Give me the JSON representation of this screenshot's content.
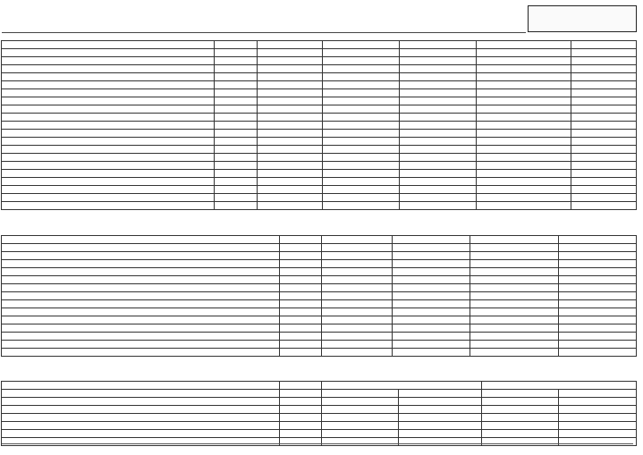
{
  "header": {
    "title": "",
    "subtitle": "",
    "box_line1": "",
    "box_line2": ""
  },
  "table1": {
    "headers": [
      "",
      "",
      "",
      "",
      "",
      "",
      ""
    ],
    "rows": [
      [
        "",
        "",
        "",
        "",
        "",
        "",
        ""
      ],
      [
        "",
        "",
        "",
        "",
        "",
        "",
        ""
      ],
      [
        "",
        "",
        "",
        "",
        "",
        "",
        ""
      ],
      [
        "",
        "",
        "",
        "",
        "",
        "",
        ""
      ],
      [
        "",
        "",
        "",
        "",
        "",
        "",
        ""
      ],
      [
        "",
        "",
        "",
        "",
        "",
        "",
        ""
      ],
      [
        "",
        "",
        "",
        "",
        "",
        "",
        ""
      ],
      [
        "",
        "",
        "",
        "",
        "",
        "",
        ""
      ],
      [
        "",
        "",
        "",
        "",
        "",
        "",
        ""
      ],
      [
        "",
        "",
        "",
        "",
        "",
        "",
        ""
      ],
      [
        "",
        "",
        "",
        "",
        "",
        "",
        ""
      ],
      [
        "",
        "",
        "",
        "",
        "",
        "",
        ""
      ],
      [
        "",
        "",
        "",
        "",
        "",
        "",
        ""
      ],
      [
        "",
        "",
        "",
        "",
        "",
        "",
        ""
      ],
      [
        "",
        "",
        "",
        "",
        "",
        "",
        ""
      ],
      [
        "",
        "",
        "",
        "",
        "",
        "",
        ""
      ],
      [
        "",
        "",
        "",
        "",
        "",
        "",
        ""
      ],
      [
        "",
        "",
        "",
        "",
        "",
        "",
        ""
      ],
      [
        "",
        "",
        "",
        "",
        "",
        "",
        ""
      ],
      [
        "",
        "",
        "",
        "",
        "",
        "",
        ""
      ]
    ]
  },
  "table2": {
    "headers": [
      "",
      "",
      "",
      "",
      "",
      ""
    ],
    "rows": [
      [
        "",
        "",
        "",
        "",
        "",
        ""
      ],
      [
        "",
        "",
        "",
        "",
        "",
        ""
      ],
      [
        "",
        "",
        "",
        "",
        "",
        ""
      ],
      [
        "",
        "",
        "",
        "",
        "",
        ""
      ],
      [
        "",
        "",
        "",
        "",
        "",
        ""
      ],
      [
        "",
        "",
        "",
        "",
        "",
        ""
      ],
      [
        "",
        "",
        "",
        "",
        "",
        ""
      ],
      [
        "",
        "",
        "",
        "",
        "",
        ""
      ],
      [
        "",
        "",
        "",
        "",
        "",
        ""
      ],
      [
        "",
        "",
        "",
        "",
        "",
        ""
      ],
      [
        "",
        "",
        "",
        "",
        "",
        ""
      ],
      [
        "",
        "",
        "",
        "",
        "",
        ""
      ],
      [
        "",
        "",
        "",
        "",
        "",
        ""
      ],
      [
        "",
        "",
        "",
        "",
        "",
        ""
      ]
    ]
  },
  "table3": {
    "group_headers": [
      "",
      "",
      "",
      ""
    ],
    "headers": [
      "",
      "",
      "",
      "",
      "",
      ""
    ],
    "rows": [
      [
        "",
        "",
        "",
        "",
        "",
        ""
      ],
      [
        "",
        "",
        "",
        "",
        "",
        ""
      ],
      [
        "",
        "",
        "",
        "",
        "",
        ""
      ],
      [
        "",
        "",
        "",
        "",
        "",
        ""
      ],
      [
        "",
        "",
        "",
        "",
        "",
        ""
      ],
      [
        "",
        "",
        "",
        "",
        "",
        ""
      ]
    ]
  },
  "footer": {
    "left": "",
    "middle": "",
    "right": ""
  }
}
